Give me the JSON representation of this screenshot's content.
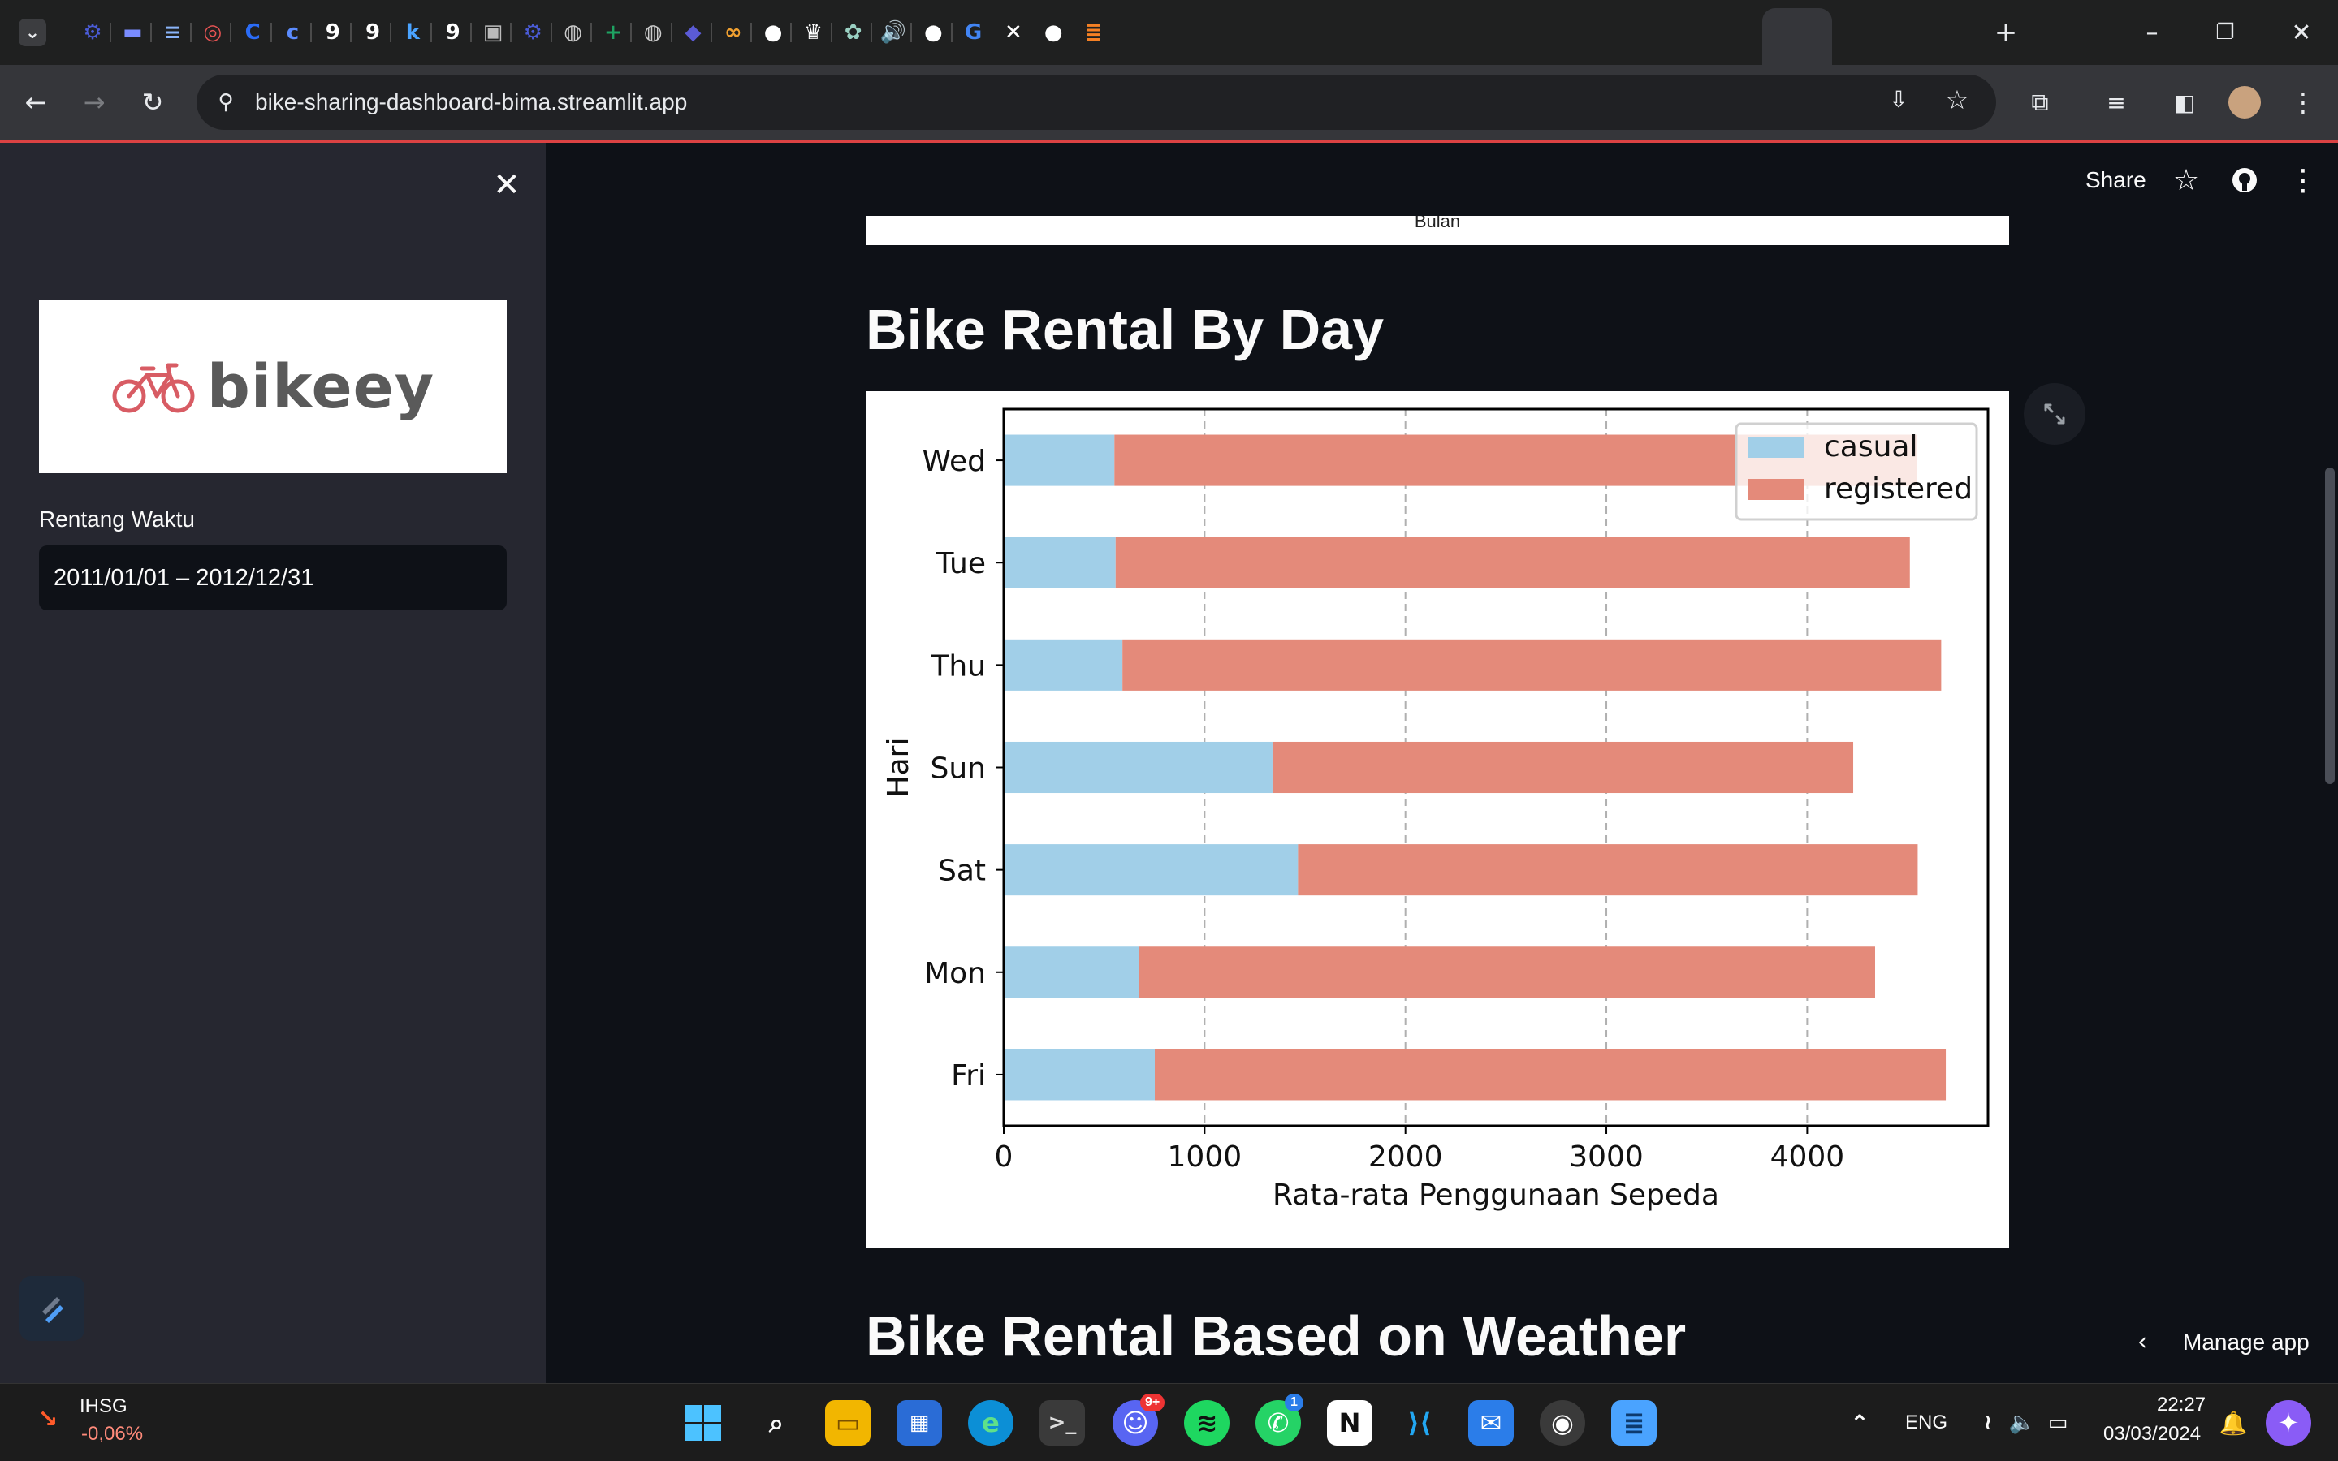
{
  "browser": {
    "url": "bike-sharing-dashboard-bima.streamlit.app",
    "tab_icons": [
      {
        "icon": "university-icon",
        "glyph": "⚙",
        "color": "#4a5bd6"
      },
      {
        "icon": "banner-icon",
        "glyph": "▬",
        "color": "#7a8cff"
      },
      {
        "icon": "list-icon",
        "glyph": "≡",
        "color": "#8ab4f8"
      },
      {
        "icon": "target-icon",
        "glyph": "◎",
        "color": "#e55353"
      },
      {
        "icon": "c-logo-icon",
        "glyph": "C",
        "color": "#2b6cf6"
      },
      {
        "icon": "c-outline-icon",
        "glyph": "c",
        "color": "#5b8cff"
      },
      {
        "icon": "g-icon",
        "glyph": "9",
        "color": "#ffffff"
      },
      {
        "icon": "g-icon",
        "glyph": "9",
        "color": "#ffffff"
      },
      {
        "icon": "k-icon",
        "glyph": "k",
        "color": "#4aa3ff"
      },
      {
        "icon": "g-icon",
        "glyph": "9",
        "color": "#ffffff"
      },
      {
        "icon": "contact-icon",
        "glyph": "▣",
        "color": "#bbbbbb"
      },
      {
        "icon": "university-icon",
        "glyph": "⚙",
        "color": "#4a5bd6"
      },
      {
        "icon": "globe-icon",
        "glyph": "◍",
        "color": "#cccccc"
      },
      {
        "icon": "plus-sheet-icon",
        "glyph": "+",
        "color": "#1ea362"
      },
      {
        "icon": "globe-icon",
        "glyph": "◍",
        "color": "#cccccc"
      },
      {
        "icon": "shield-icon",
        "glyph": "◆",
        "color": "#5b5bd6"
      },
      {
        "icon": "infinity-icon",
        "glyph": "∞",
        "color": "#f0a030"
      },
      {
        "icon": "github-icon",
        "glyph": "●",
        "color": "#ffffff"
      },
      {
        "icon": "crown-icon",
        "glyph": "♛",
        "color": "#ffffff"
      },
      {
        "icon": "openai-icon",
        "glyph": "✿",
        "color": "#9ad0c2"
      },
      {
        "icon": "speaker-icon",
        "glyph": "🔊",
        "color": "#dddddd"
      },
      {
        "icon": "github-icon",
        "glyph": "●",
        "color": "#ffffff"
      },
      {
        "icon": "translate-icon",
        "glyph": "G",
        "color": "#4285f4"
      },
      {
        "icon": "close-icon",
        "glyph": "✕",
        "color": "#ffffff"
      },
      {
        "icon": "github-icon",
        "glyph": "●",
        "color": "#ffffff"
      },
      {
        "icon": "stackoverflow-icon",
        "glyph": "≣",
        "color": "#f48024"
      }
    ]
  },
  "sidebar": {
    "logo_text": "bikeey",
    "date_range_label": "Rentang Waktu",
    "date_range_value": "2011/01/01 – 2012/12/31"
  },
  "header": {
    "share_label": "Share"
  },
  "main": {
    "previous_chart_xlabel": "Bulan",
    "section_title_day": "Bike Rental By Day",
    "section_title_weather": "Bike Rental Based on Weather",
    "manage_app_label": "Manage app"
  },
  "chart_data": {
    "type": "bar",
    "orientation": "horizontal",
    "stacked": true,
    "categories": [
      "Wed",
      "Tue",
      "Thu",
      "Sun",
      "Sat",
      "Mon",
      "Fri"
    ],
    "series": [
      {
        "name": "casual",
        "color": "#a1cfe8",
        "values": [
          551,
          557,
          591,
          1338,
          1465,
          674,
          752
        ]
      },
      {
        "name": "registered",
        "color": "#e48a7a",
        "values": [
          3997,
          3954,
          4076,
          2891,
          3085,
          3664,
          3938
        ]
      }
    ],
    "xlabel": "Rata-rata Penggunaan Sepeda",
    "ylabel": "Hari",
    "xlim": [
      0,
      4900
    ],
    "xticks": [
      "0",
      "1000",
      "2000",
      "3000",
      "4000"
    ],
    "grid": "x-dashed",
    "legend_position": "top-right"
  },
  "taskbar": {
    "stock_name": "IHSG",
    "stock_change": "-0,06%",
    "language": "ENG",
    "time": "22:27",
    "date": "03/03/2024",
    "discord_badge": "9+",
    "whatsapp_badge": "1"
  }
}
